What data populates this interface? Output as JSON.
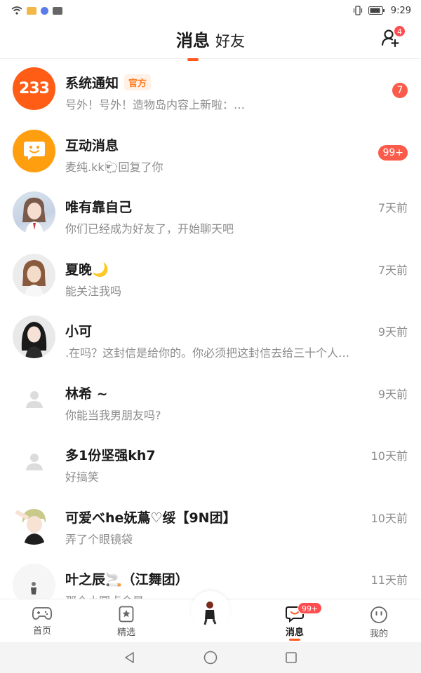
{
  "status_bar": {
    "time": "9:29"
  },
  "header": {
    "tab_messages": "消息",
    "tab_friends": "好友",
    "add_friend_badge": "4"
  },
  "conversations": [
    {
      "name": "系统通知",
      "tag": "官方",
      "preview": "号外！号外！造物岛内容上新啦：…",
      "badge": "7",
      "avatar_text": "233"
    },
    {
      "name": "互动消息",
      "preview": "麦纯.kk🐑回复了你",
      "badge": "99+"
    },
    {
      "name": "唯有靠自己",
      "preview": "你们已经成为好友了，开始聊天吧",
      "time": "7天前"
    },
    {
      "name": "夏晚🌙",
      "preview": "能关注我吗",
      "time": "7天前"
    },
    {
      "name": "小可",
      "preview": ".在吗？这封信是给你的。你必须把这封信去给三十个人…",
      "time": "9天前"
    },
    {
      "name": "林希 ~",
      "preview": "你能当我男朋友吗?",
      "time": "9天前"
    },
    {
      "name": "多1份坚强kh7",
      "preview": "好搞笑",
      "time": "10天前"
    },
    {
      "name": "可爱べhe妩蔦♡绥【9N团】",
      "preview": "弄了个眼镜袋",
      "time": "10天前"
    },
    {
      "name": "叶之辰🚬（江舞团）",
      "preview": "那个小圆点会是",
      "time": "11天前"
    }
  ],
  "bottom_nav": {
    "home": "首页",
    "featured": "精选",
    "messages": "消息",
    "messages_badge": "99+",
    "mine": "我的"
  },
  "colors": {
    "accent": "#ff5a1f",
    "badge": "#ff4d4f",
    "muted_text": "#8c8c8c"
  },
  "icons": [
    "wifi-icon",
    "add-friend-icon",
    "chat-smile-icon",
    "default-user-icon",
    "gamepad-icon",
    "star-icon",
    "chat-icon",
    "smile-icon",
    "back-icon",
    "home-circle-icon",
    "recents-icon"
  ]
}
